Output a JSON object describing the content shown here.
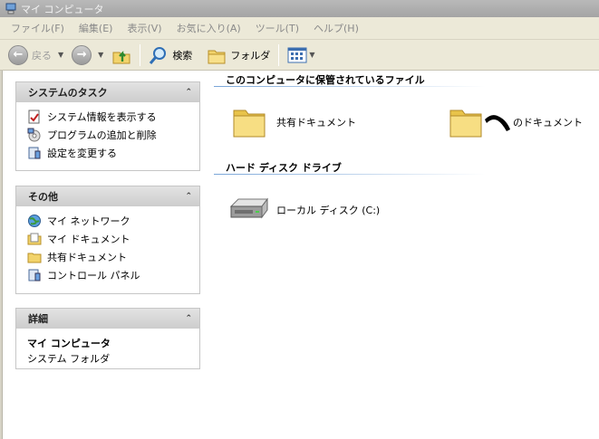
{
  "window": {
    "title": "マイ コンピュータ"
  },
  "menu": [
    "ファイル(F)",
    "編集(E)",
    "表示(V)",
    "お気に入り(A)",
    "ツール(T)",
    "ヘルプ(H)"
  ],
  "toolbar": {
    "back": "戻る",
    "search": "検索",
    "folders": "フォルダ"
  },
  "tasks": {
    "header": "システムのタスク",
    "items": [
      "システム情報を表示する",
      "プログラムの追加と削除",
      "設定を変更する"
    ]
  },
  "other": {
    "header": "その他",
    "items": [
      "マイ ネットワーク",
      "マイ ドキュメント",
      "共有ドキュメント",
      "コントロール パネル"
    ]
  },
  "details": {
    "header": "詳細",
    "title": "マイ コンピュータ",
    "subtitle": "システム フォルダ"
  },
  "main": {
    "stored_files": {
      "heading": "このコンピュータに保管されているファイル",
      "items": [
        "共有ドキュメント",
        "のドキュメント"
      ]
    },
    "hard_disk": {
      "heading": "ハード ディスク ドライブ",
      "items": [
        "ローカル ディスク (C:)"
      ]
    }
  }
}
